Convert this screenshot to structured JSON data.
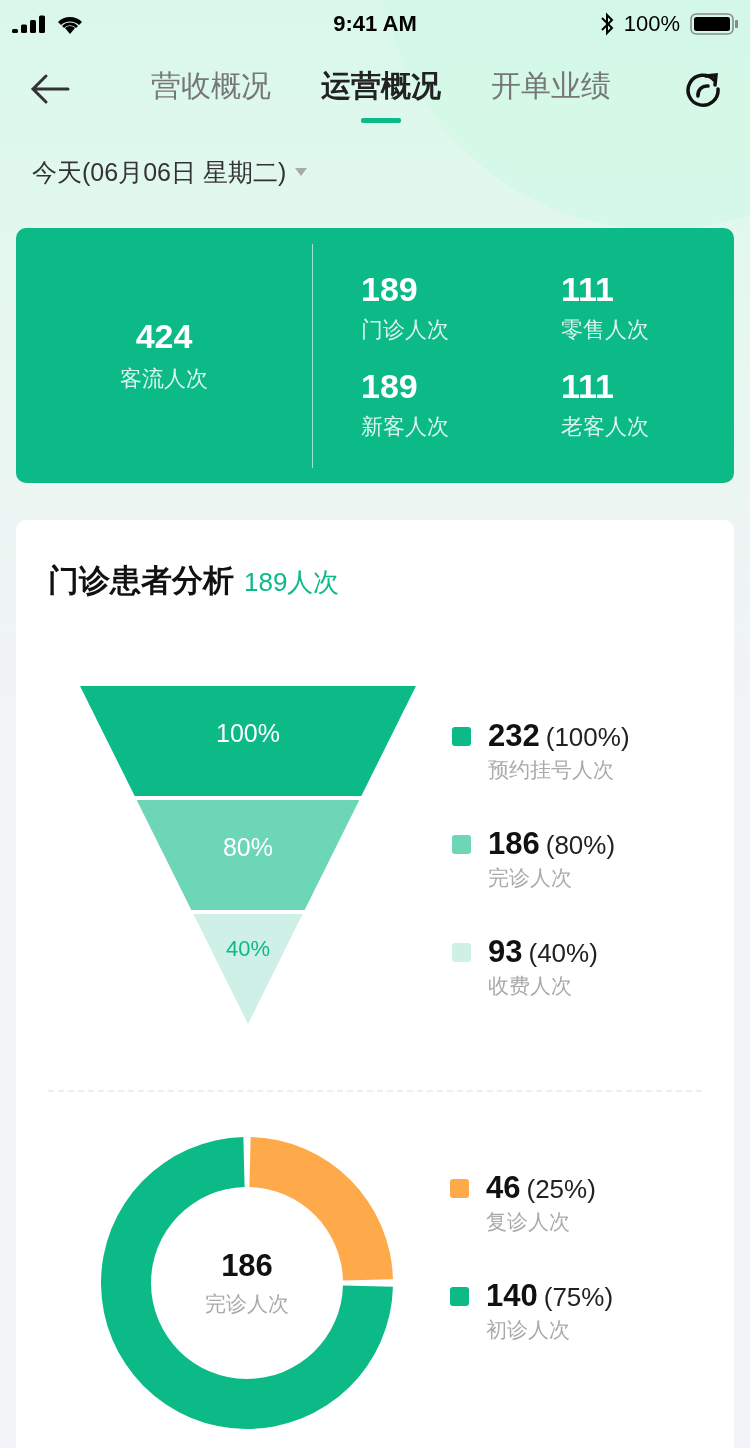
{
  "status_bar": {
    "time": "9:41 AM",
    "battery": "100%"
  },
  "tabs": [
    {
      "label": "营收概况",
      "selected": false
    },
    {
      "label": "运营概况",
      "selected": true
    },
    {
      "label": "开单业绩",
      "selected": false
    }
  ],
  "date_picker": {
    "value": "今天(06月06日 星期二)"
  },
  "summary": {
    "total": {
      "value": "424",
      "label": "客流人次"
    },
    "stats": [
      {
        "value": "189",
        "label": "门诊人次"
      },
      {
        "value": "111",
        "label": "零售人次"
      },
      {
        "value": "189",
        "label": "新客人次"
      },
      {
        "value": "111",
        "label": "老客人次"
      }
    ]
  },
  "analysis": {
    "title": "门诊患者分析",
    "count": "189人次",
    "funnel": [
      {
        "percent": "100%",
        "color": "#0bba87",
        "value": "232",
        "share": "(100%)",
        "label": "预约挂号人次"
      },
      {
        "percent": "80%",
        "color": "#6dd6b7",
        "value": "186",
        "share": "(80%)",
        "label": "完诊人次"
      },
      {
        "percent": "40%",
        "color": "#cff0e6",
        "value": "93",
        "share": "(40%)",
        "label": "收费人次"
      }
    ],
    "donut": {
      "center_value": "186",
      "center_label": "完诊人次",
      "chart_data": {
        "type": "donut",
        "categories": [
          "复诊人次",
          "初诊人次"
        ],
        "values": [
          25,
          75
        ]
      },
      "legend": [
        {
          "value": "46",
          "share": "(25%)",
          "color": "#ffaa4a"
        },
        {
          "value": "140",
          "share": "(75%)",
          "color": "#0bba87"
        }
      ]
    }
  }
}
